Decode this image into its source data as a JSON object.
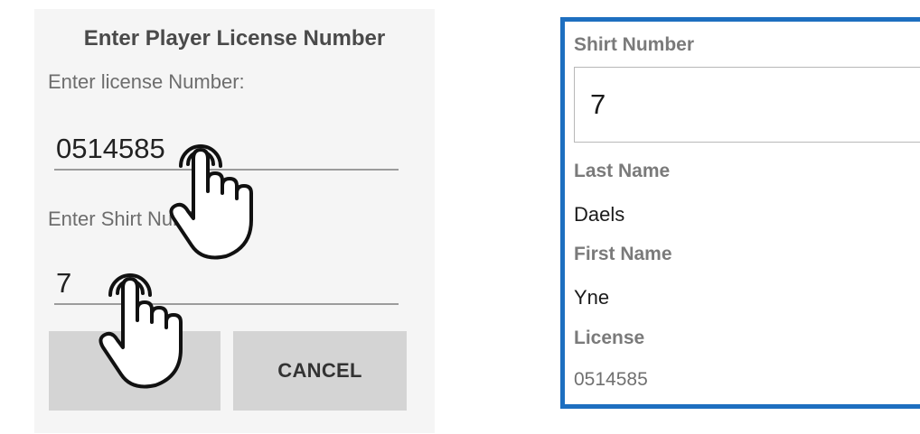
{
  "dialog": {
    "title": "Enter Player License Number",
    "license_prompt": "Enter license Number:",
    "license_value": "0514585",
    "shirt_prompt": "Enter Shirt Number:",
    "shirt_value": "7",
    "ok_label": "OK",
    "cancel_label": "CANCEL"
  },
  "player": {
    "shirt_label": "Shirt Number",
    "shirt_value": "7",
    "last_name_label": "Last Name",
    "last_name_value": "Daels",
    "first_name_label": "First Name",
    "first_name_value": "Yne",
    "license_label": "License",
    "license_value": "0514585"
  },
  "colors": {
    "panel_border": "#1e6fc0",
    "button_bg": "#d4d4d4",
    "dialog_bg": "#f5f5f5"
  },
  "icons": [
    "tap-hand-icon"
  ]
}
